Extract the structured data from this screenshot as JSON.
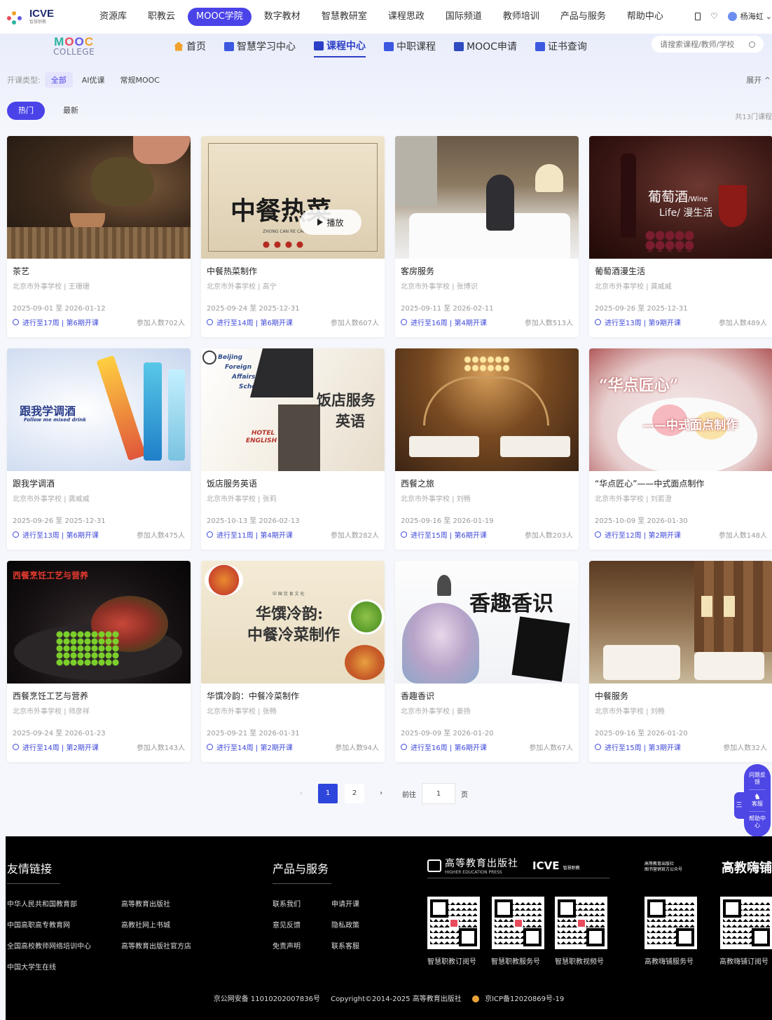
{
  "topbar": {
    "logo_text": "icve",
    "logo_sub": "智慧职教",
    "nav": [
      "资源库",
      "职教云",
      "MOOC学院",
      "数字教材",
      "智慧教研室",
      "课程思政",
      "国际频道",
      "教师培训",
      "产品与服务",
      "帮助中心"
    ],
    "active_nav": "MOOC学院",
    "user_name": "杨海虹"
  },
  "mooc": {
    "logo_letters": [
      "M",
      "O",
      "O",
      "C"
    ],
    "logo_sub": "COLLEGE",
    "subnav": [
      "首页",
      "智慧学习中心",
      "课程中心",
      "中职课程",
      "MOOC申请",
      "证书查询"
    ],
    "active_subnav": "课程中心",
    "search_placeholder": "请搜索课程/教师/学校"
  },
  "filters": {
    "type_label": "开课类型:",
    "options": [
      "全部",
      "AI优课",
      "常规MOOC"
    ],
    "expand": "展开 ^",
    "sort": [
      "热门",
      "最新"
    ],
    "total": "共13门课程"
  },
  "courses": [
    {
      "title": "茶艺",
      "school": "北京市外事学校 | 王珊珊",
      "dates": "2025-09-01 至 2026-01-12",
      "progress": "进行至17周 | 第6期开课",
      "joined": "参加人数702人"
    },
    {
      "title": "中餐热菜制作",
      "school": "北京市外事学校 | 高宁",
      "dates": "2025-09-24 至 2025-12-31",
      "progress": "进行至14周 | 第6期开课",
      "joined": "参加人数607人"
    },
    {
      "title": "客房服务",
      "school": "北京市外事学校 | 张博识",
      "dates": "2025-09-11 至 2026-02-11",
      "progress": "进行至16周 | 第4期开课",
      "joined": "参加人数513人"
    },
    {
      "title": "葡萄酒漫生活",
      "school": "北京市外事学校 | 龚威威",
      "dates": "2025-09-26 至 2025-12-31",
      "progress": "进行至13周 | 第9期开课",
      "joined": "参加人数489人"
    },
    {
      "title": "跟我学调酒",
      "school": "北京市外事学校 | 龚威威",
      "dates": "2025-09-26 至 2025-12-31",
      "progress": "进行至13周 | 第6期开课",
      "joined": "参加人数475人"
    },
    {
      "title": "饭店服务英语",
      "school": "北京市外事学校 | 张莉",
      "dates": "2025-10-13 至 2026-02-13",
      "progress": "进行至11周 | 第4期开课",
      "joined": "参加人数282人"
    },
    {
      "title": "西餐之旅",
      "school": "北京市外事学校 | 刘畅",
      "dates": "2025-09-16 至 2026-01-19",
      "progress": "进行至15周 | 第6期开课",
      "joined": "参加人数203人"
    },
    {
      "title": "“华点匠心”——中式面点制作",
      "school": "北京市外事学校 | 刘若澄",
      "dates": "2025-10-09 至 2026-01-30",
      "progress": "进行至12周 | 第2期开课",
      "joined": "参加人数148人"
    },
    {
      "title": "西餐烹饪工艺与营养",
      "school": "北京市外事学校 | 师彦祥",
      "dates": "2025-09-24 至 2026-01-23",
      "progress": "进行至14周 | 第2期开课",
      "joined": "参加人数143人"
    },
    {
      "title": "华馔冷韵：中餐冷菜制作",
      "school": "北京市外事学校 | 张畅",
      "dates": "2025-09-21 至 2026-01-31",
      "progress": "进行至14周 | 第2期开课",
      "joined": "参加人数94人"
    },
    {
      "title": "香趣香识",
      "school": "北京市外事学校 | 姜扬",
      "dates": "2025-09-09 至 2026-01-20",
      "progress": "进行至16周 | 第6期开课",
      "joined": "参加人数67人"
    },
    {
      "title": "中餐服务",
      "school": "北京市外事学校 | 刘畅",
      "dates": "2025-09-16 至 2026-01-20",
      "progress": "进行至15周 | 第3期开课",
      "joined": "参加人数32人"
    }
  ],
  "thumb_text": {
    "c2_main": "中餐热菜",
    "c2_sub": "ZHONG CAN RE CAI",
    "c2_play": "播放",
    "c4_main": "葡萄酒",
    "c4_wine": "/Wine",
    "c4_sub": "Life/ 漫生活",
    "c5_main": "跟我学调酒",
    "c5_sub": "Follow me mixed drink",
    "c6_a": "Beijing",
    "c6_b": "Foreign",
    "c6_c": "Affairs",
    "c6_d": "School",
    "c6_main": "饭店服务",
    "c6_main2": "英语",
    "c6_en": "HOTEL",
    "c6_en2": "ENGLISH",
    "c8_main": "“华点匠心”",
    "c8_sub": "——中式面点制作",
    "c9_main": "西餐烹饪工艺与营养",
    "c10_top": "中 国 饮 食 文 化",
    "c10_main": "华馔冷韵:",
    "c10_sub": "中餐冷菜制作",
    "c11_main": "香趣香识"
  },
  "pagination": {
    "prev": "‹",
    "pages": [
      "1",
      "2"
    ],
    "current": "1",
    "next": "›",
    "goto_label": "前往",
    "goto_value": "1",
    "page_suffix": "页"
  },
  "float_tools": {
    "feedback": "问题反馈",
    "service": "客服",
    "help": "帮助中心",
    "side": "三"
  },
  "footer": {
    "links_title": "友情链接",
    "links": [
      "中华人民共和国教育部",
      "高等教育出版社",
      "中国高职高专教育网",
      "高教社网上书城",
      "全国高校教师网络培训中心",
      "高等教育出版社官方店",
      "中国大学生在线"
    ],
    "products_title": "产品与服务",
    "products": [
      "联系我们",
      "申请开课",
      "意见反馈",
      "隐私政策",
      "免责声明",
      "联系客服"
    ],
    "hep_name": "高等教育出版社",
    "hep_en": "HIGHER EDUCATION PRESS",
    "icve": "icve",
    "icve_sub": "智慧职教",
    "gj_small": "高等教育出版社",
    "gj_small2": "图书营销官方公众号",
    "gj_name": "高教嗨铺",
    "qr_labels": [
      "智慧职教订阅号",
      "智慧职教服务号",
      "智慧职教视频号",
      "高教嗨铺服务号",
      "高教嗨铺订阅号"
    ],
    "copyright_a": "京公网安备 11010202007836号",
    "copyright_b": "Copyright©2014-2025 高等教育出版社",
    "copyright_c": "京ICP备12020869号-19"
  }
}
